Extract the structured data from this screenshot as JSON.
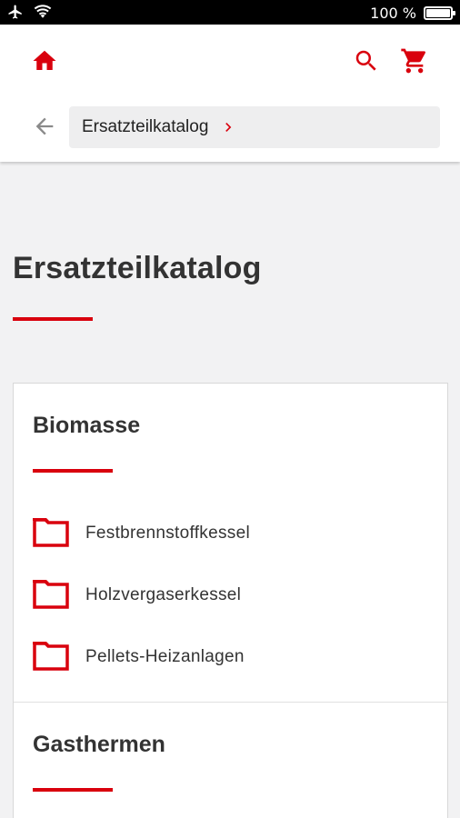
{
  "status_bar": {
    "battery_text": "100 %",
    "icons": [
      "airplane-icon",
      "wifi-icon",
      "battery-icon"
    ]
  },
  "header": {
    "breadcrumb": {
      "label": "Ersatzteilkatalog"
    },
    "icons": [
      "home-icon",
      "search-icon",
      "cart-icon",
      "back-arrow-icon",
      "chevron-right-icon"
    ]
  },
  "page": {
    "title": "Ersatzteilkatalog"
  },
  "sections": [
    {
      "title": "Biomasse",
      "items": [
        {
          "label": "Festbrennstoffkessel"
        },
        {
          "label": "Holzvergaserkessel"
        },
        {
          "label": "Pellets-Heizanlagen"
        }
      ]
    },
    {
      "title": "Gasthermen",
      "items": []
    }
  ],
  "colors": {
    "accent": "#d9000d",
    "background": "#f2f2f3",
    "text": "#333333"
  }
}
